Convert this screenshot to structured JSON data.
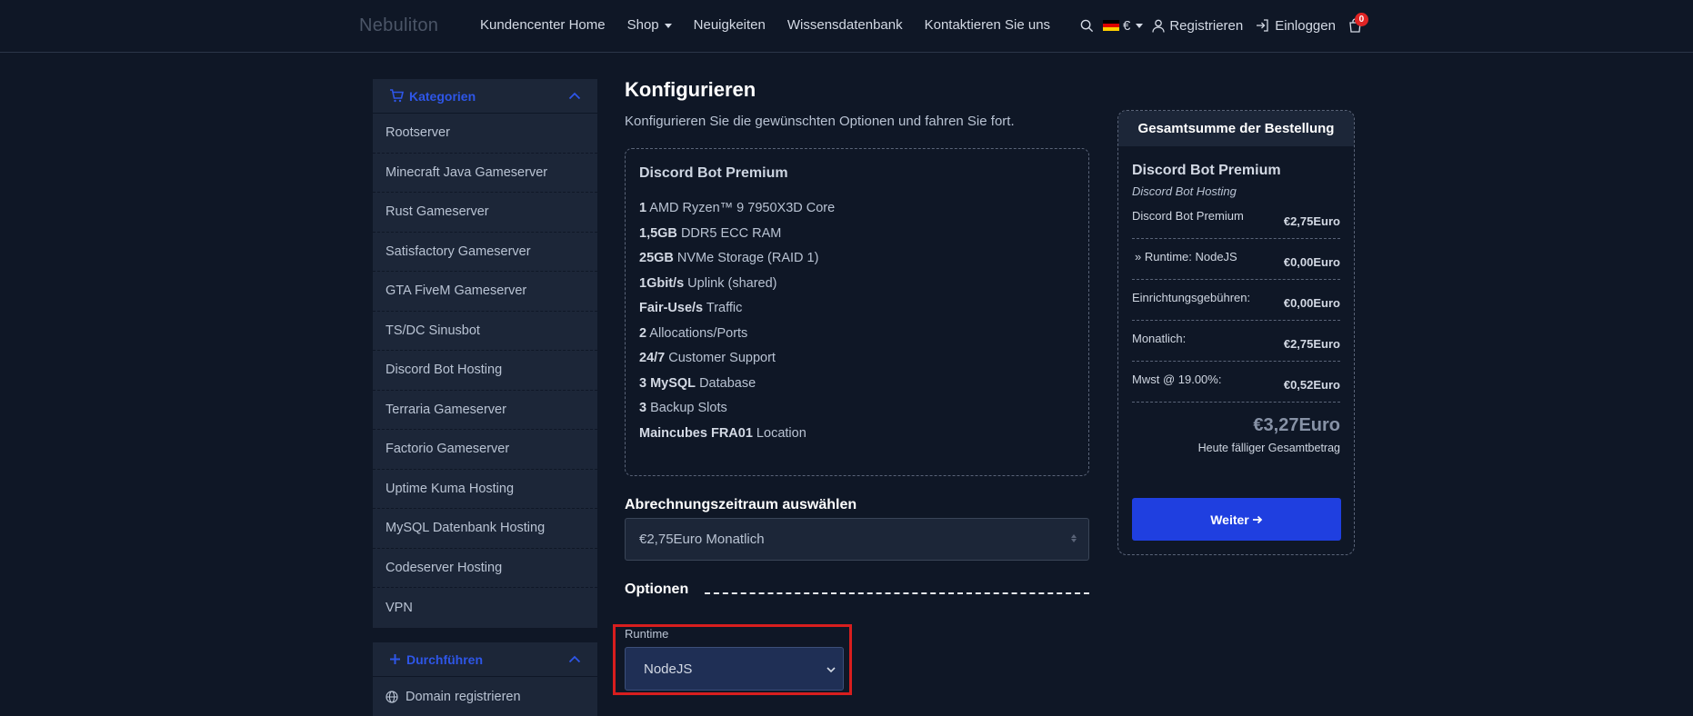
{
  "navbar": {
    "brand": "Nebuliton",
    "links": [
      {
        "label": "Kundencenter Home"
      },
      {
        "label": "Shop",
        "dropdown": true
      },
      {
        "label": "Neuigkeiten"
      },
      {
        "label": "Wissensdatenbank"
      },
      {
        "label": "Kontaktieren Sie uns"
      }
    ],
    "currency": "€",
    "register_label": "Registrieren",
    "login_label": "Einloggen",
    "cart_count": "0",
    "icons": [
      "search-icon",
      "flag-de-icon",
      "user-icon",
      "login-icon",
      "cart-icon"
    ]
  },
  "sidebar": {
    "categories_title": "Kategorien",
    "categories": [
      "Rootserver",
      "Minecraft Java Gameserver",
      "Rust Gameserver",
      "Satisfactory Gameserver",
      "GTA FiveM Gameserver",
      "TS/DC Sinusbot",
      "Discord Bot Hosting",
      "Terraria Gameserver",
      "Factorio Gameserver",
      "Uptime Kuma Hosting",
      "MySQL Datenbank Hosting",
      "Codeserver Hosting",
      "VPN"
    ],
    "actions_title": "Durchführen",
    "actions": [
      "Domain registrieren"
    ]
  },
  "main": {
    "title": "Konfigurieren",
    "subtitle": "Konfigurieren Sie die gewünschten Optionen und fahren Sie fort.",
    "product": {
      "name": "Discord Bot Premium",
      "features": [
        {
          "bold": "1",
          "text": " AMD Ryzen™ 9 7950X3D Core"
        },
        {
          "bold": "1,5GB",
          "text": " DDR5 ECC RAM"
        },
        {
          "bold": "25GB",
          "text": " NVMe Storage (RAID 1)"
        },
        {
          "bold": "1Gbit/s",
          "text": " Uplink (shared)"
        },
        {
          "bold": "Fair-Use/s",
          "text": " Traffic"
        },
        {
          "bold": "2",
          "text": " Allocations/Ports"
        },
        {
          "bold": "24/7",
          "text": " Customer Support"
        },
        {
          "bold": "3 MySQL",
          "text": " Database"
        },
        {
          "bold": "3",
          "text": " Backup Slots"
        },
        {
          "bold": "Maincubes FRA01",
          "text": " Location"
        }
      ]
    },
    "billing_title": "Abrechnungszeitraum auswählen",
    "billing_value": "€2,75Euro Monatlich",
    "options_title": "Optionen",
    "runtime_label": "Runtime",
    "runtime_value": "NodeJS"
  },
  "summary": {
    "title": "Gesamtsumme der Bestellung",
    "product_name": "Discord Bot Premium",
    "product_group": "Discord Bot Hosting",
    "rows": [
      {
        "label": "Discord Bot Premium",
        "value": "€2,75Euro"
      },
      {
        "label": "» Runtime: NodeJS",
        "value": "€0,00Euro"
      },
      {
        "label": "Einrichtungsgebühren:",
        "value": "€0,00Euro"
      },
      {
        "label": "Monatlich:",
        "value": "€2,75Euro"
      },
      {
        "label": "Mwst @ 19.00%:",
        "value": "€0,52Euro"
      }
    ],
    "total": "€3,27Euro",
    "total_caption": "Heute fälliger Gesamtbetrag",
    "continue_label": "Weiter"
  },
  "colors": {
    "background": "#0f1726",
    "panel": "#1c2638",
    "accent": "#1f3fe0",
    "highlight": "#d81e1e"
  }
}
